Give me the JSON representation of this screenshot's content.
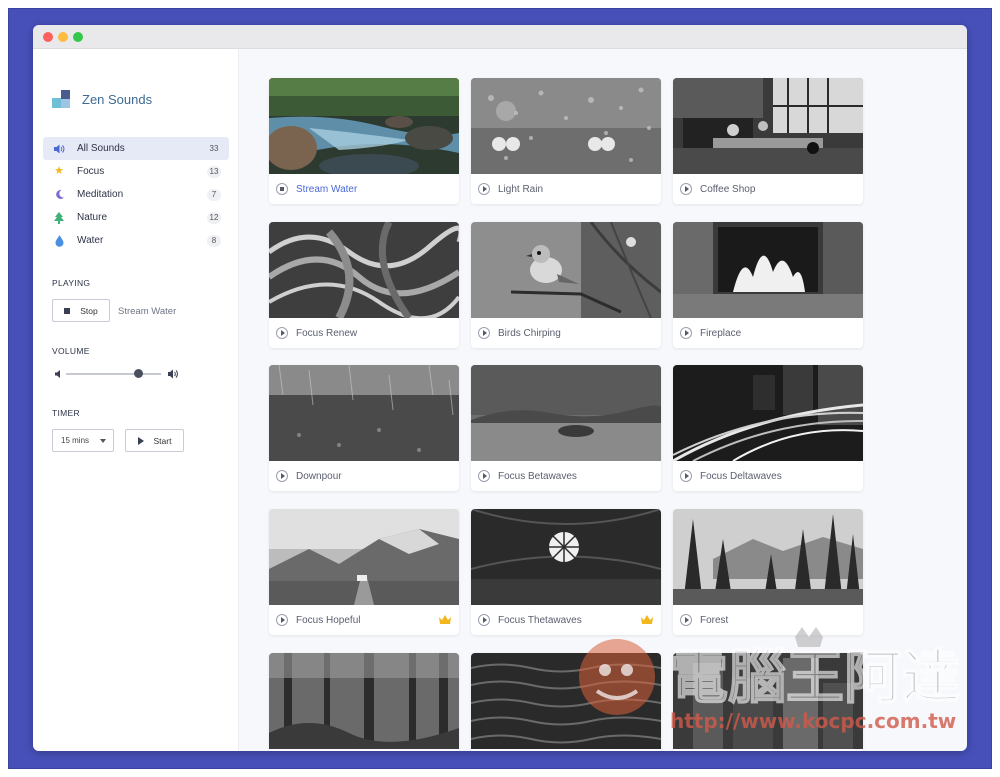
{
  "app": {
    "name": "Zen Sounds"
  },
  "categories": [
    {
      "label": "All Sounds",
      "count": "33",
      "icon": "speaker-icon",
      "color": "#4a68d6"
    },
    {
      "label": "Focus",
      "count": "13",
      "icon": "star-icon",
      "color": "#f2b61f"
    },
    {
      "label": "Meditation",
      "count": "7",
      "icon": "moon-icon",
      "color": "#7a6cd8"
    },
    {
      "label": "Nature",
      "count": "12",
      "icon": "tree-icon",
      "color": "#3fb07a"
    },
    {
      "label": "Water",
      "count": "8",
      "icon": "drop-icon",
      "color": "#4a8fe0"
    }
  ],
  "playing": {
    "heading": "PLAYING",
    "stop_label": "Stop",
    "current": "Stream Water"
  },
  "volume": {
    "heading": "VOLUME",
    "level": 0.78
  },
  "timer": {
    "heading": "TIMER",
    "selected": "15 mins",
    "start_label": "Start"
  },
  "sounds": [
    {
      "name": "Stream Water",
      "state": "playing",
      "premium": false
    },
    {
      "name": "Light Rain",
      "state": "idle",
      "premium": false
    },
    {
      "name": "Coffee Shop",
      "state": "idle",
      "premium": false
    },
    {
      "name": "Focus Renew",
      "state": "idle",
      "premium": false
    },
    {
      "name": "Birds Chirping",
      "state": "idle",
      "premium": false
    },
    {
      "name": "Fireplace",
      "state": "idle",
      "premium": false
    },
    {
      "name": "Downpour",
      "state": "idle",
      "premium": false
    },
    {
      "name": "Focus Betawaves",
      "state": "idle",
      "premium": false
    },
    {
      "name": "Focus Deltawaves",
      "state": "idle",
      "premium": false
    },
    {
      "name": "Focus Hopeful",
      "state": "idle",
      "premium": true
    },
    {
      "name": "Focus Thetawaves",
      "state": "idle",
      "premium": true
    },
    {
      "name": "Forest",
      "state": "idle",
      "premium": false
    },
    {
      "name": "",
      "state": "idle",
      "premium": false
    },
    {
      "name": "",
      "state": "idle",
      "premium": false
    },
    {
      "name": "",
      "state": "idle",
      "premium": false
    }
  ],
  "watermark": {
    "text": "電腦王阿達",
    "url": "http://www.kocpc.com.tw"
  },
  "colors": {
    "accent": "#4a68d6",
    "frame": "#4650b8",
    "crown": "#f2b61f"
  }
}
